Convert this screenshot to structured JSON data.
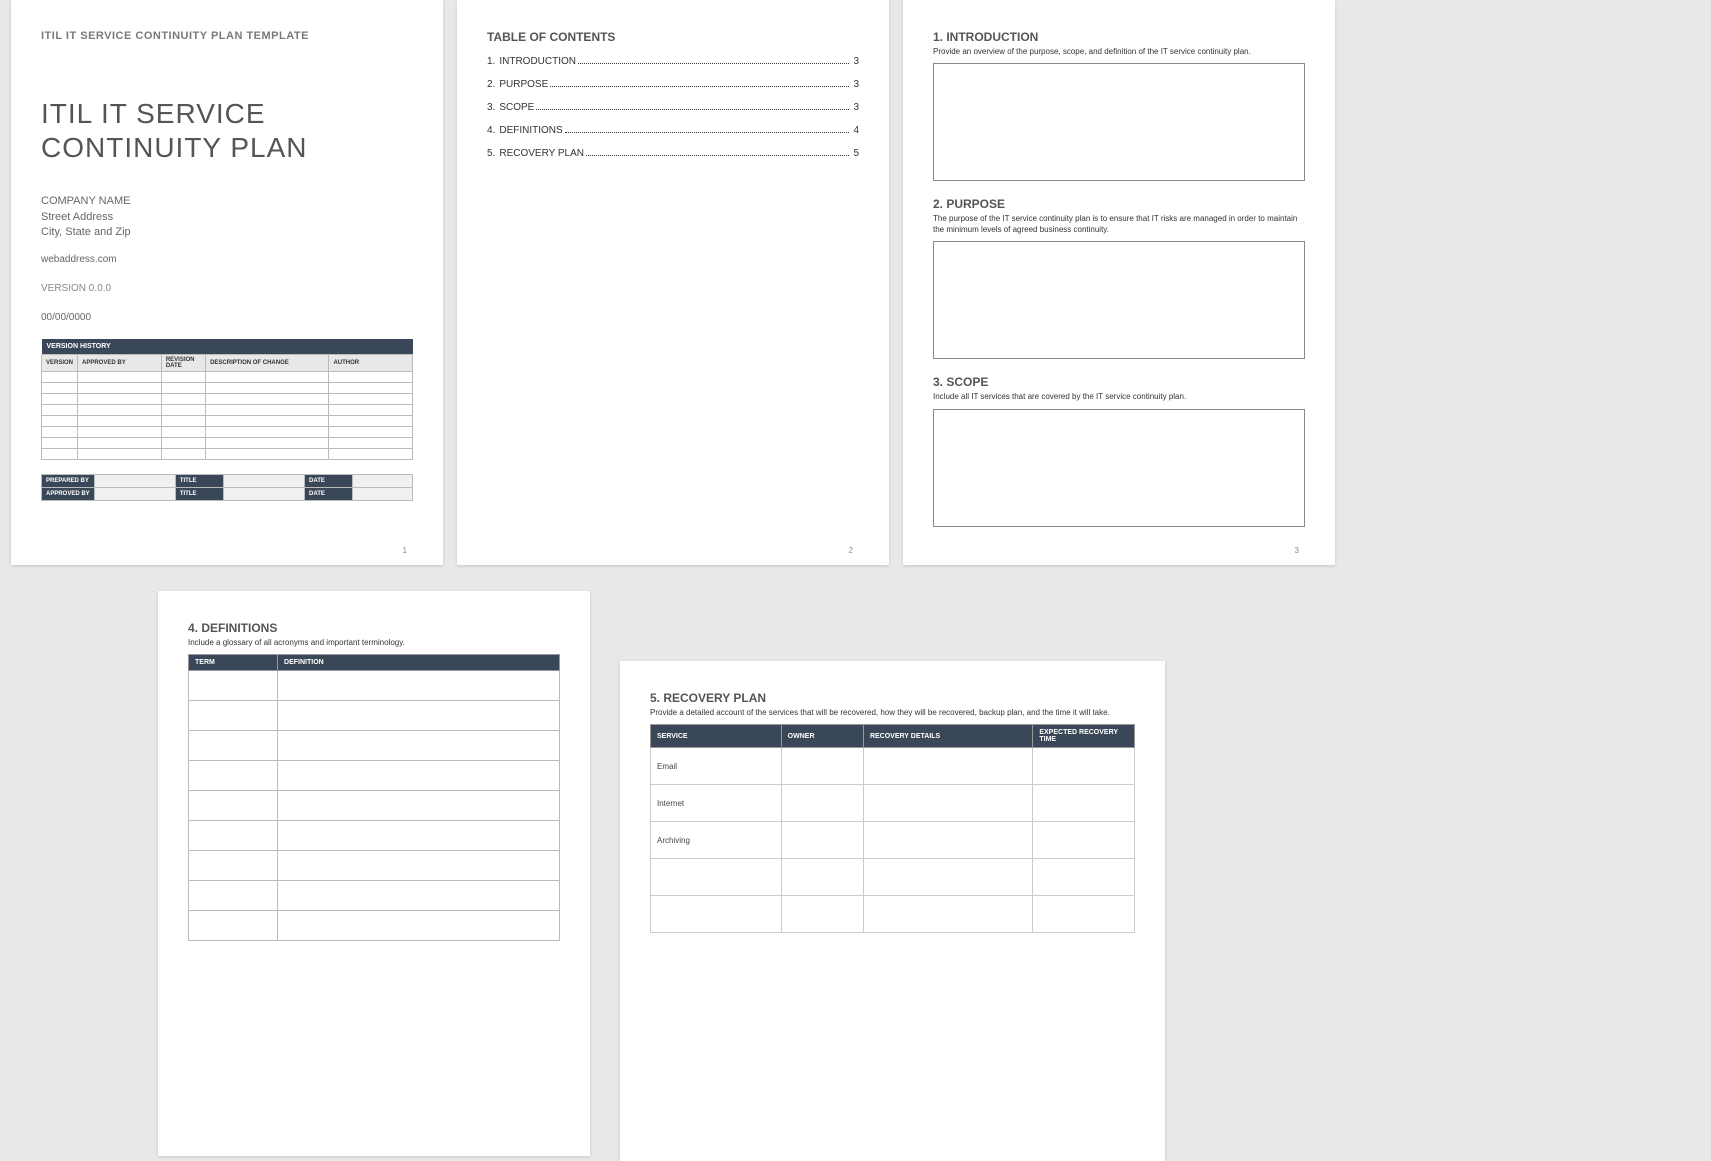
{
  "page1": {
    "header": "ITIL IT SERVICE CONTINUITY PLAN TEMPLATE",
    "title": "ITIL IT SERVICE CONTINUITY PLAN",
    "company_name": "COMPANY NAME",
    "street": "Street Address",
    "city": "City, State and Zip",
    "web": "webaddress.com",
    "version": "VERSION 0.0.0",
    "date": "00/00/0000",
    "version_history_label": "VERSION HISTORY",
    "version_cols": {
      "version": "VERSION",
      "approved_by": "APPROVED BY",
      "revision_date": "REVISION DATE",
      "desc": "DESCRIPTION OF CHANGE",
      "author": "AUTHOR"
    },
    "approval": {
      "prepared_by": "PREPARED BY",
      "approved_by": "APPROVED BY",
      "title": "TITLE",
      "date": "DATE"
    },
    "page_num": "1"
  },
  "page2": {
    "toc_title": "TABLE OF CONTENTS",
    "entries": [
      {
        "num": "1.",
        "label": "INTRODUCTION",
        "page": "3"
      },
      {
        "num": "2.",
        "label": "PURPOSE",
        "page": "3"
      },
      {
        "num": "3.",
        "label": "SCOPE",
        "page": "3"
      },
      {
        "num": "4.",
        "label": "DEFINITIONS",
        "page": "4"
      },
      {
        "num": "5.",
        "label": "RECOVERY PLAN",
        "page": "5"
      }
    ],
    "page_num": "2"
  },
  "page3": {
    "intro": {
      "heading": "1.  INTRODUCTION",
      "desc": "Provide an overview of the purpose, scope, and definition of the IT service continuity plan."
    },
    "purpose": {
      "heading": "2.  PURPOSE",
      "desc": "The purpose of the IT service continuity plan is to ensure that IT risks are managed in order to maintain the minimum levels of agreed business continuity."
    },
    "scope": {
      "heading": "3.  SCOPE",
      "desc": "Include all IT services that are covered by the IT service continuity plan."
    },
    "page_num": "3"
  },
  "page4": {
    "definitions": {
      "heading": "4.  DEFINITIONS",
      "desc": "Include a glossary of all acronyms and important terminology.",
      "term_col": "TERM",
      "def_col": "DEFINITION"
    }
  },
  "page5": {
    "recovery": {
      "heading": "5.  RECOVERY PLAN",
      "desc": "Provide a detailed account of the services that will be recovered, how they will be recovered, backup plan, and the time it will take.",
      "cols": {
        "service": "SERVICE",
        "owner": "OWNER",
        "details": "RECOVERY DETAILS",
        "time": "EXPECTED RECOVERY TIME"
      },
      "services": [
        "Email",
        "Internet",
        "Archiving",
        "",
        ""
      ]
    }
  }
}
